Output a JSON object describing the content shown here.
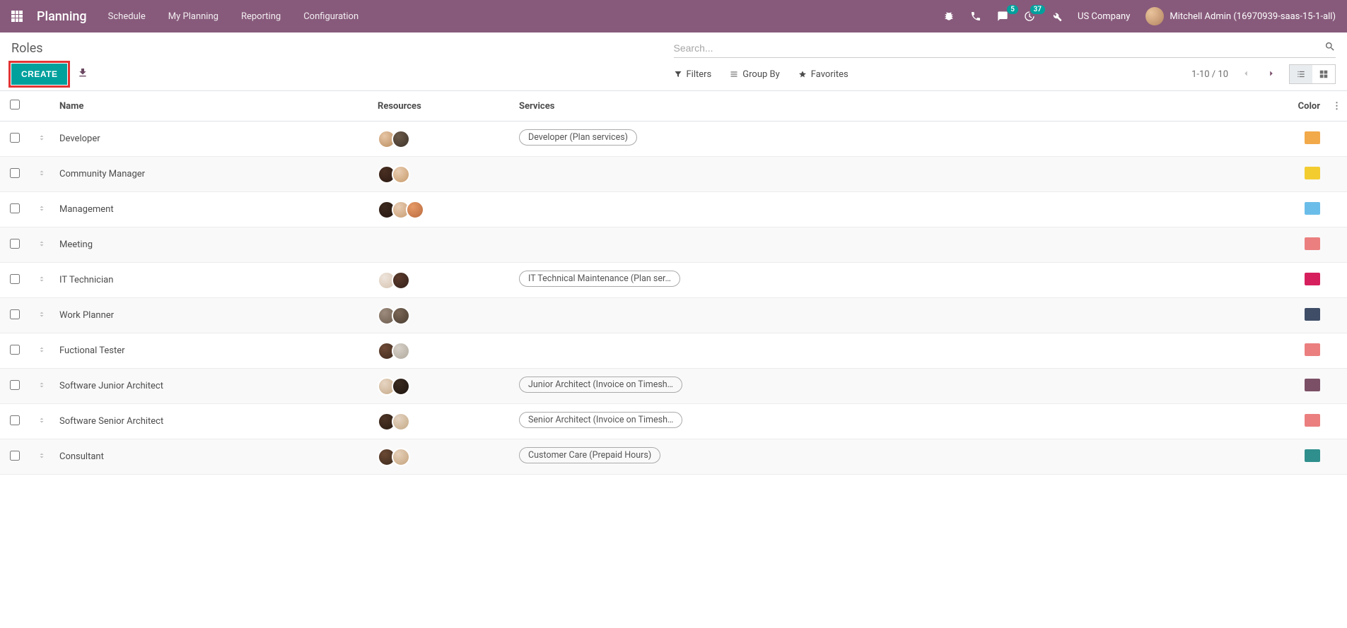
{
  "topbar": {
    "brand": "Planning",
    "menu": [
      "Schedule",
      "My Planning",
      "Reporting",
      "Configuration"
    ],
    "messages_badge": "5",
    "activities_badge": "37",
    "company": "US Company",
    "user": "Mitchell Admin (16970939-saas-15-1-all)"
  },
  "breadcrumb": "Roles",
  "search_placeholder": "Search...",
  "create_label": "CREATE",
  "filters_label": "Filters",
  "groupby_label": "Group By",
  "favorites_label": "Favorites",
  "pager": "1-10 / 10",
  "columns": {
    "name": "Name",
    "resources": "Resources",
    "services": "Services",
    "color": "Color"
  },
  "rows": [
    {
      "name": "Developer",
      "avatars": [
        "#e7c6a6,#b88c5e",
        "#6b5a49,#3f342a"
      ],
      "service": "Developer (Plan services)",
      "color": "#f2a94a"
    },
    {
      "name": "Community Manager",
      "avatars": [
        "#4a2f22,#2a1912",
        "#e9cdb2,#c79a6a"
      ],
      "service": "",
      "color": "#f3cc30"
    },
    {
      "name": "Management",
      "avatars": [
        "#3e2a1f,#23160f",
        "#e8cdb4,#c79b70",
        "#e69a67,#b96a3e"
      ],
      "service": "",
      "color": "#6bbde9"
    },
    {
      "name": "Meeting",
      "avatars": [],
      "service": "",
      "color": "#eb7f7f"
    },
    {
      "name": "IT Technician",
      "avatars": [
        "#efe5dc,#d4c2af",
        "#5b3b2c,#34211a"
      ],
      "service": "IT Technical Maintenance (Plan ser…",
      "color": "#d6205e"
    },
    {
      "name": "Work Planner",
      "avatars": [
        "#9d8c7e,#6c5c4e",
        "#7a6656,#4a3d31"
      ],
      "service": "",
      "color": "#3f4d67"
    },
    {
      "name": "Fuctional Tester",
      "avatars": [
        "#6e4a36,#3f2a1e",
        "#d7d1c9,#b0a89c"
      ],
      "service": "",
      "color": "#eb7f7f"
    },
    {
      "name": "Software Junior Architect",
      "avatars": [
        "#e7d5c3,#c5a988",
        "#3a2a1f,#1e1510"
      ],
      "service": "Junior Architect (Invoice on Timesh…",
      "color": "#7b5066"
    },
    {
      "name": "Software Senior Architect",
      "avatars": [
        "#4c3425,#2b1c13",
        "#e5d4c3,#c3a884"
      ],
      "service": "Senior Architect (Invoice on Timesh…",
      "color": "#eb7f7f"
    },
    {
      "name": "Consultant",
      "avatars": [
        "#6a4933,#3c291c",
        "#e6d1bb,#c4a27b"
      ],
      "service": "Customer Care (Prepaid Hours)",
      "color": "#2f8f8c"
    }
  ]
}
